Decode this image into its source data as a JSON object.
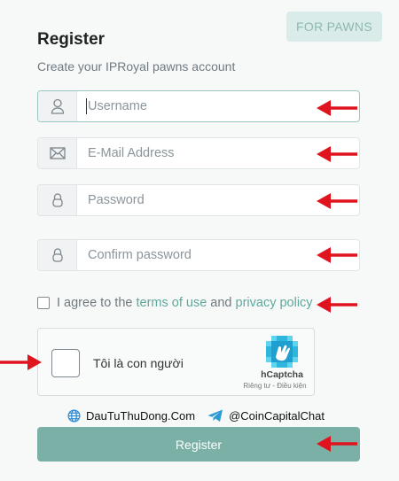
{
  "badge": "FOR PAWNS",
  "title": "Register",
  "subtitle": "Create your IPRoyal pawns account",
  "fields": {
    "username": {
      "placeholder": "Username",
      "icon": "user-icon"
    },
    "email": {
      "placeholder": "E-Mail Address",
      "icon": "envelope-icon"
    },
    "password": {
      "placeholder": "Password",
      "icon": "lock-icon"
    },
    "confirm": {
      "placeholder": "Confirm password",
      "icon": "lock-icon"
    }
  },
  "agree": {
    "prefix": "I agree to the",
    "terms": "terms of use",
    "and": "and",
    "privacy": "privacy policy"
  },
  "captcha": {
    "label": "Tôi là con người",
    "brand": "hCaptcha",
    "legal": "Riêng tư - Điều kiện"
  },
  "credits": {
    "site": "DauTuThuDong.Com",
    "telegram": "@CoinCapitalChat"
  },
  "submit_label": "Register",
  "colors": {
    "accent": "#7bb0a6",
    "link": "#5ea89b",
    "arrow": "#e0141e",
    "badge_bg": "#d9ece9"
  }
}
